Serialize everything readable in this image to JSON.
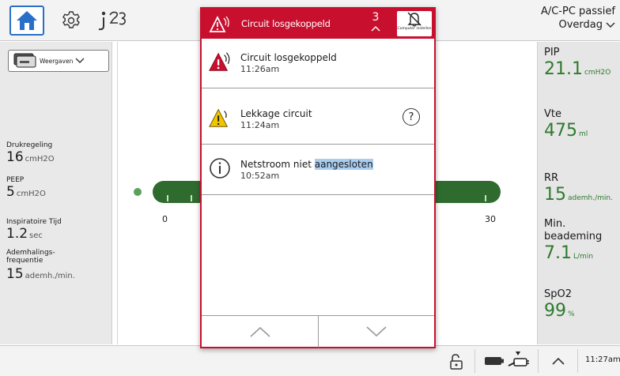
{
  "top_bar": {
    "icons": [
      "home-icon",
      "gear-icon",
      "patient-info-icon"
    ],
    "mode": "A/C-PC passief",
    "preset": "Overdag"
  },
  "left_panel": {
    "view_button": "Weergaven",
    "params": [
      {
        "label": "Drukregeling",
        "value": "16",
        "unit": "cmH2O"
      },
      {
        "label": "PEEP",
        "value": "5",
        "unit": "cmH2O"
      },
      {
        "label": "Inspiratoire Tijd",
        "value": "1.2",
        "unit": "sec"
      },
      {
        "label": "Ademhalings-\nfrequentie",
        "value": "15",
        "unit": "ademh./min."
      }
    ]
  },
  "center": {
    "scale_min": "0",
    "scale_max": "30"
  },
  "right_panel": {
    "params": [
      {
        "label": "PIP",
        "value": "21.1",
        "unit": "cmH2O"
      },
      {
        "label": "Vte",
        "value": "475",
        "unit": "ml"
      },
      {
        "label": "RR",
        "value": "15",
        "unit": "ademh./min."
      },
      {
        "label": "Min.\nbeademing",
        "value": "7.1",
        "unit": "L/min"
      },
      {
        "label": "SpO2",
        "value": "99",
        "unit": "%"
      }
    ]
  },
  "alarm_popup": {
    "header_title": "Circuit losgekoppeld",
    "count": "3",
    "silence_label": "Computer instellen",
    "items": [
      {
        "severity": "high",
        "title": "Circuit losgekoppeld",
        "time": "11:26am"
      },
      {
        "severity": "medium",
        "title": "Lekkage circuit",
        "time": "11:24am"
      },
      {
        "severity": "info",
        "title_plain": "Netstroom niet ",
        "title_highlight": "aangesloten",
        "time": "10:52am"
      }
    ]
  },
  "bottom_bar": {
    "time": "11:27am"
  },
  "colors": {
    "alarm_red": "#c8102e",
    "accent_blue": "#2a6fc7",
    "value_green": "#2f7a2f",
    "gauge_green": "#2f6b2f",
    "highlight": "#a9cdf0"
  }
}
